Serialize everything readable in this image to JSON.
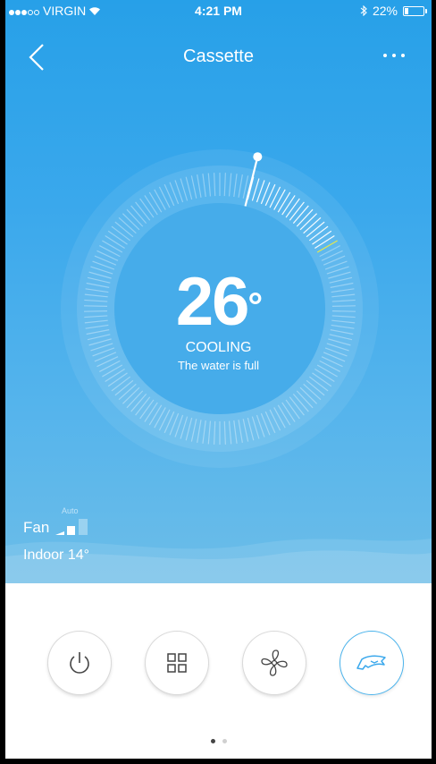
{
  "status_bar": {
    "carrier": "VIRGIN",
    "time": "4:21 PM",
    "battery": "22%",
    "battery_level": 0.22
  },
  "nav": {
    "title": "Cassette",
    "back_icon": "chevron-left-icon",
    "more_icon": "more-dots-icon"
  },
  "thermostat": {
    "temperature": "26",
    "degree_symbol": "°",
    "mode": "COOLING",
    "message": "The water is full"
  },
  "fan": {
    "label": "Fan",
    "speed_label": "Auto"
  },
  "indoor": {
    "label": "Indoor 14°"
  },
  "controls": [
    {
      "name": "power",
      "icon": "power-icon",
      "active": false
    },
    {
      "name": "mode",
      "icon": "grid-icon",
      "active": false
    },
    {
      "name": "fan",
      "icon": "fan-icon",
      "active": false
    },
    {
      "name": "swing",
      "icon": "swing-icon",
      "active": true
    }
  ],
  "pager": {
    "pages": 2,
    "current": 1
  },
  "colors": {
    "accent": "#4ab3ec",
    "hero_top": "#27a0e8",
    "hero_bottom": "#6cbde8",
    "marker_yellow": "#e8e84a"
  }
}
